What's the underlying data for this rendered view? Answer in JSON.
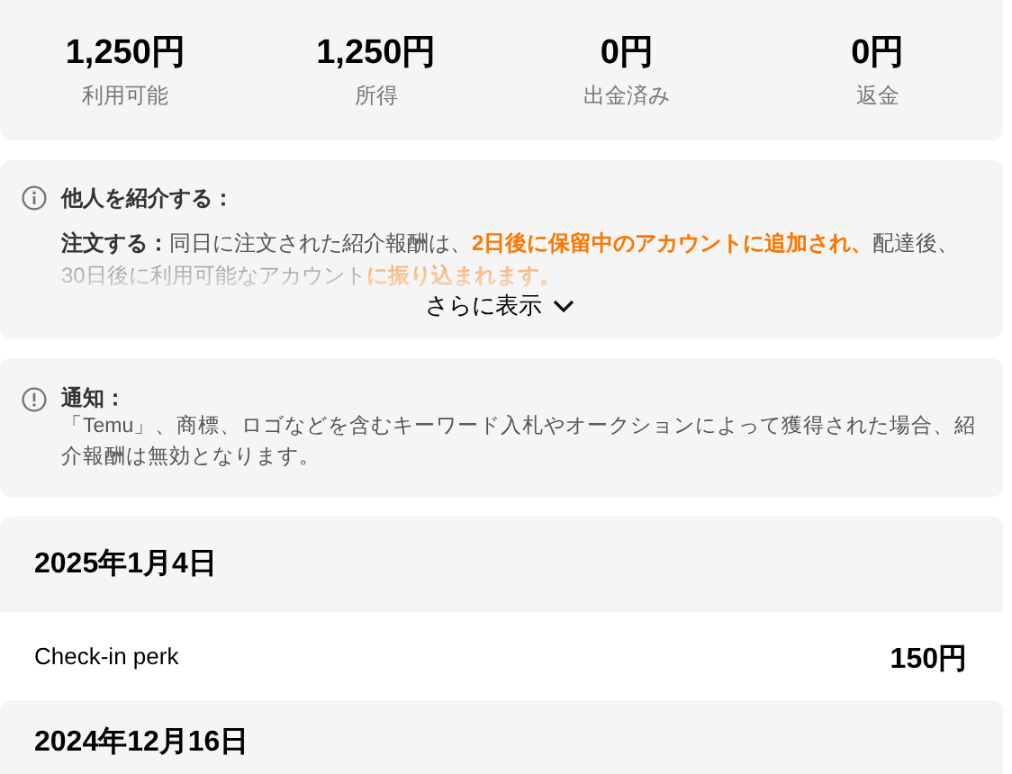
{
  "stats": [
    {
      "amount": "1,250円",
      "label": "利用可能"
    },
    {
      "amount": "1,250円",
      "label": "所得"
    },
    {
      "amount": "0円",
      "label": "出金済み"
    },
    {
      "amount": "0円",
      "label": "返金"
    }
  ],
  "referral": {
    "title": "他人を紹介する：",
    "parts": [
      {
        "kind": "label",
        "text": "注文する："
      },
      {
        "kind": "text",
        "text": "同日に注文された紹介報酬は、"
      },
      {
        "kind": "highlight",
        "text": "2日後に保留中のアカウントに追加され、"
      },
      {
        "kind": "text",
        "text": "配達後、30日後に利用可能なアカウント"
      },
      {
        "kind": "highlight",
        "text": "に振り込まれます。"
      }
    ],
    "more": "さらに表示"
  },
  "notice": {
    "title": "通知：",
    "text": "「Temu」、商標、ロゴなどを含むキーワード入札やオークションによって獲得された場合、紹介報酬は無効となります。"
  },
  "history": [
    {
      "date": "2025年1月4日",
      "entries": [
        {
          "name": "Check-in perk",
          "amount": "150円"
        }
      ]
    },
    {
      "date": "2024年12月16日"
    }
  ]
}
